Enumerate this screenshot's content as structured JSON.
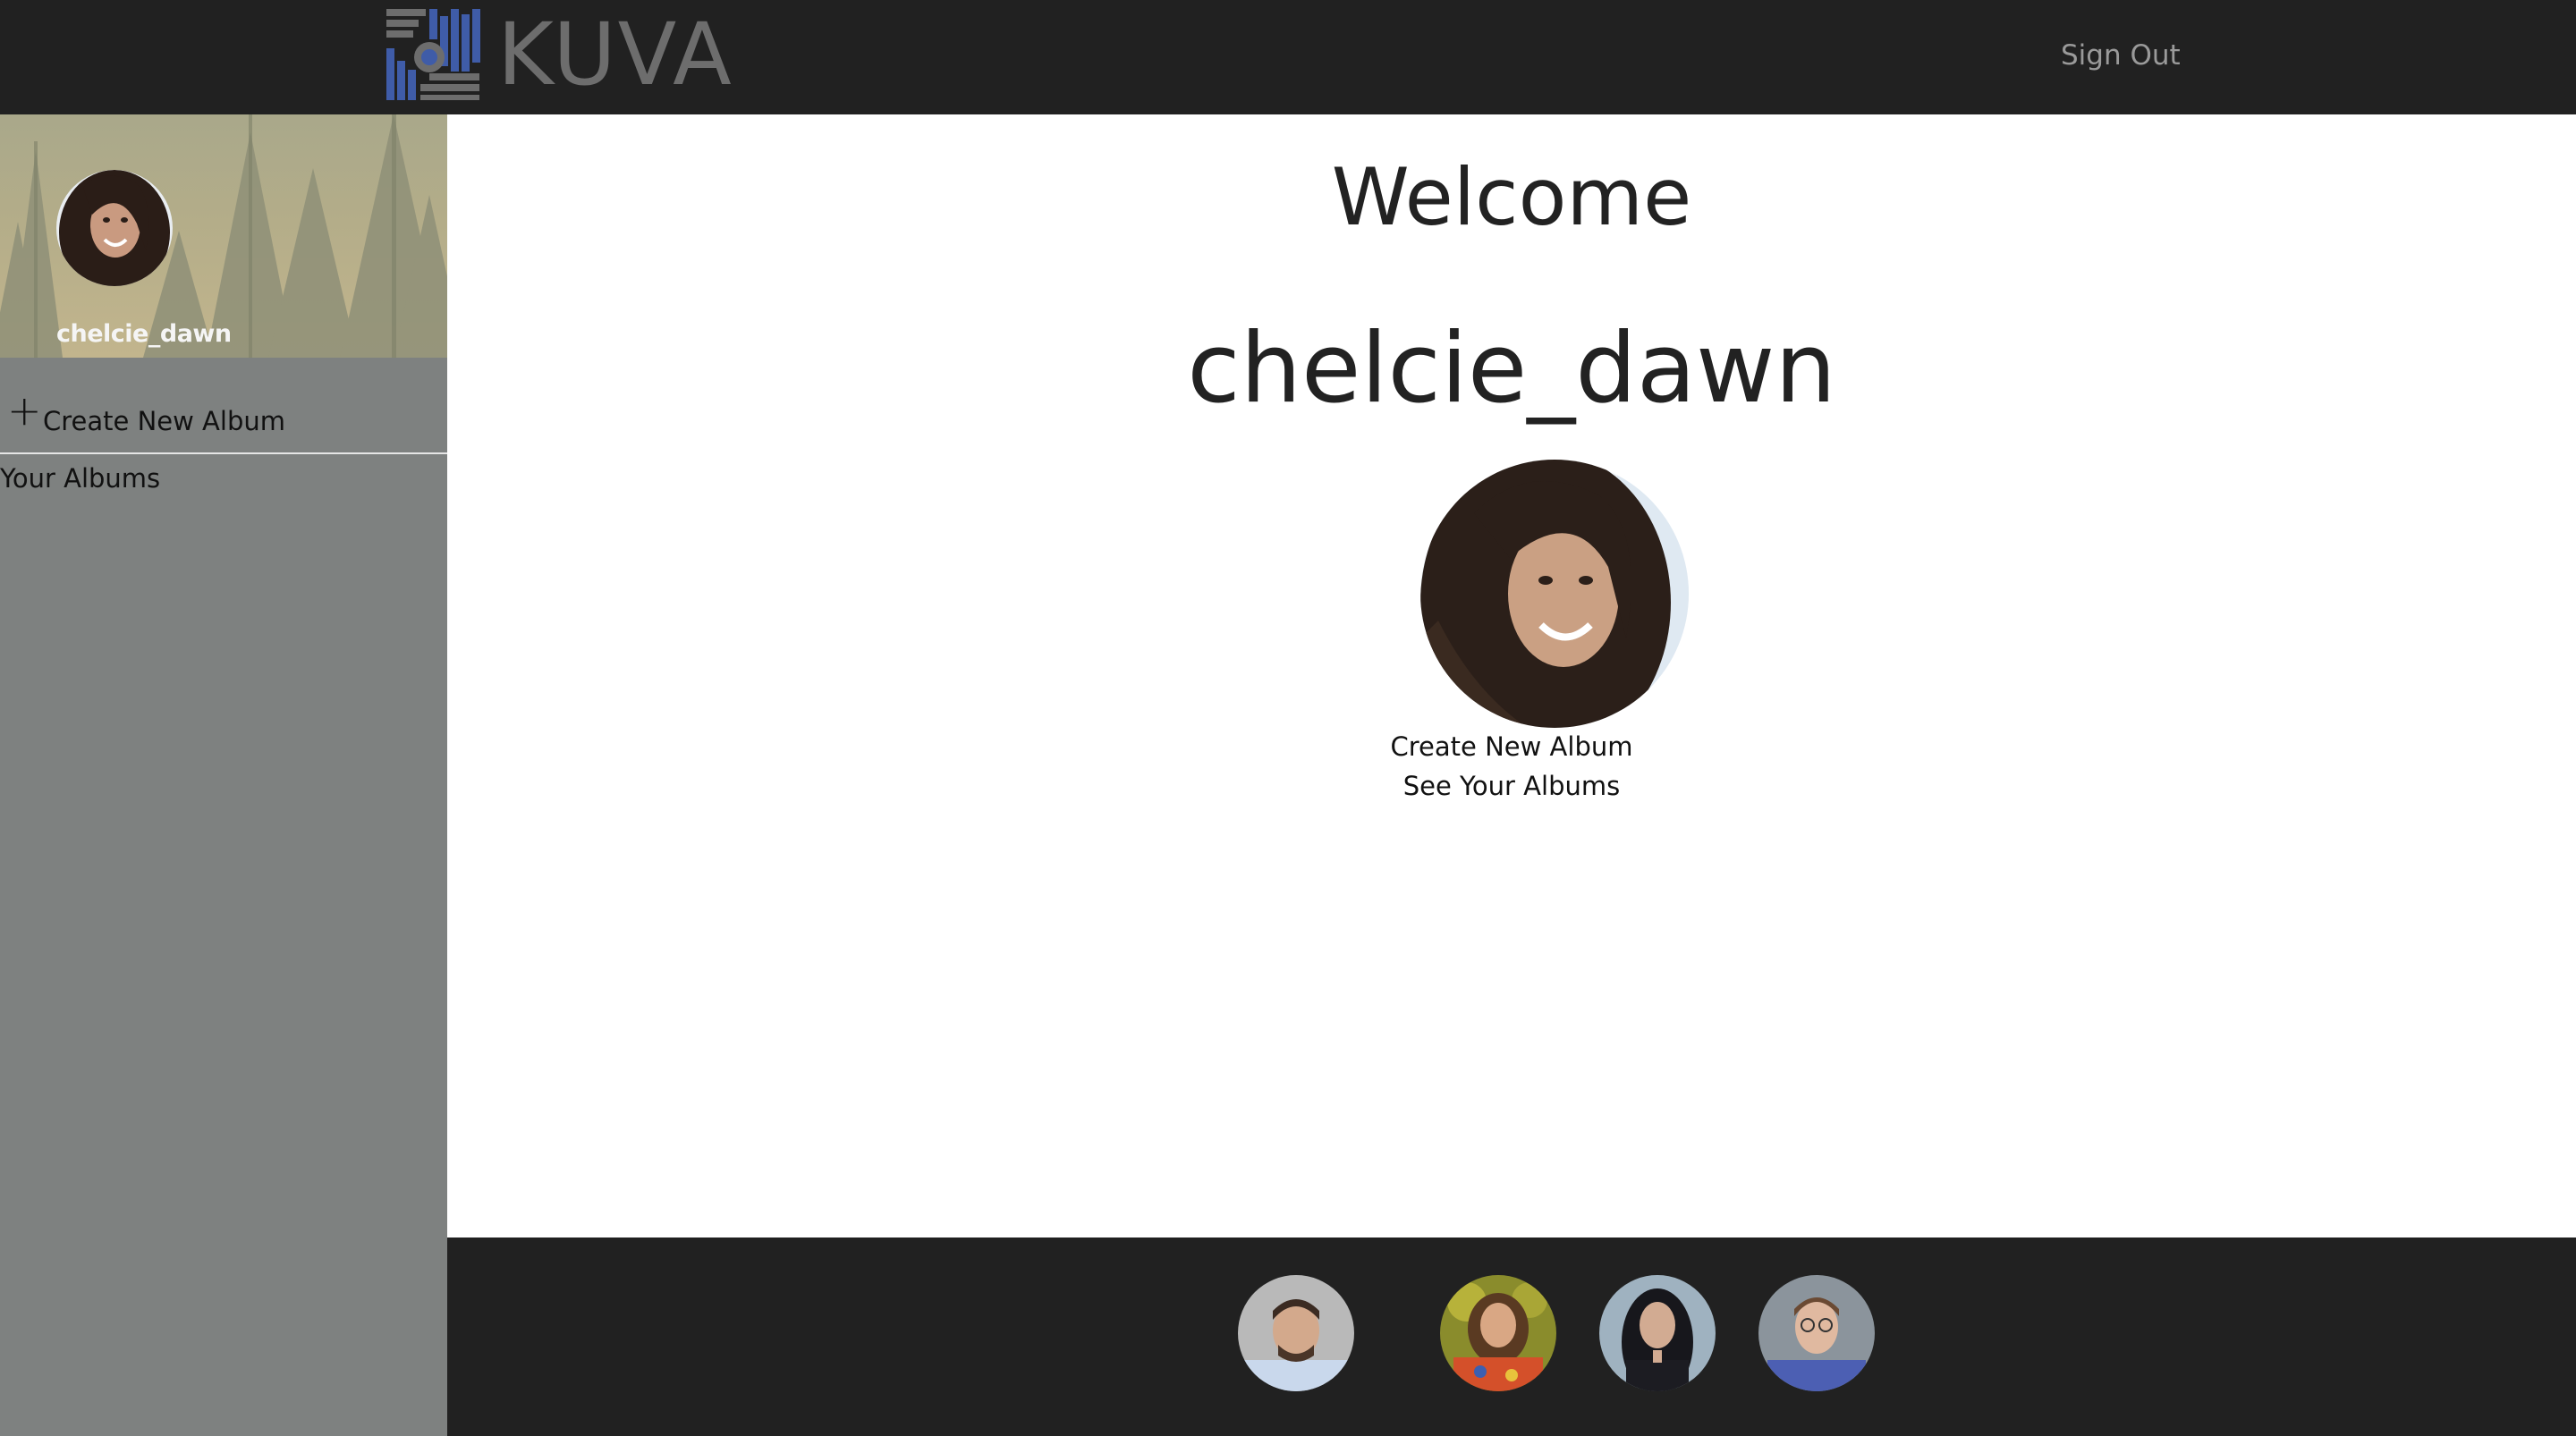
{
  "header": {
    "logo_text": "KUVA",
    "sign_out_label": "Sign Out"
  },
  "sidebar": {
    "username": "chelcie_dawn",
    "create_new_album_label": "Create New Album",
    "your_albums_label": "Your Albums"
  },
  "main": {
    "welcome_text": "Welcome",
    "username": "chelcie_dawn",
    "create_new_album_link": "Create New Album",
    "see_your_albums_link": "See Your Albums"
  },
  "footer": {
    "team_avatars": [
      "avatar",
      "avatar",
      "avatar",
      "avatar"
    ]
  },
  "colors": {
    "topbar_bg": "#212121",
    "sidebar_bg": "#7e8180",
    "footer_bg": "#212121",
    "logo_blue": "#3f5ca8",
    "logo_gray": "#6d6d6d"
  },
  "icons": [
    "kuva-logo-icon",
    "plus-icon",
    "user-avatar-icon"
  ]
}
